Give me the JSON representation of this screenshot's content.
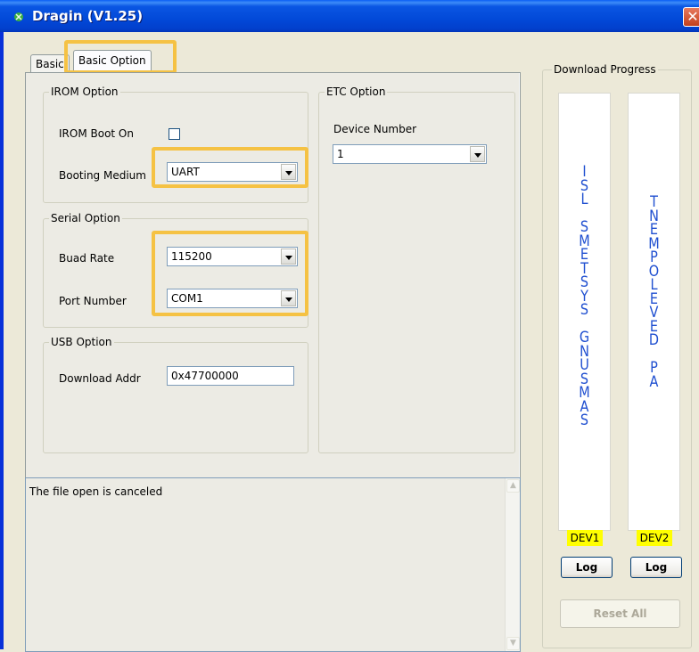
{
  "window": {
    "title": "Dragin (V1.25)",
    "close_icon": "close-icon"
  },
  "tabs": [
    {
      "label": "Basic",
      "active": false
    },
    {
      "label": "Basic Option",
      "active": true
    }
  ],
  "irom": {
    "group_label": "IROM Option",
    "boot_on_label": "IROM Boot On",
    "boot_on_checked": false,
    "booting_medium_label": "Booting Medium",
    "booting_medium_value": "UART"
  },
  "serial": {
    "group_label": "Serial Option",
    "baud_label": "Buad Rate",
    "baud_value": "115200",
    "port_label": "Port Number",
    "port_value": "COM1"
  },
  "usb": {
    "group_label": "USB Option",
    "addr_label": "Download Addr",
    "addr_value": "0x47700000"
  },
  "etc": {
    "group_label": "ETC Option",
    "device_number_label": "Device Number",
    "device_number_value": "1"
  },
  "log": {
    "text": "The file open is canceled"
  },
  "download": {
    "group_label": "Download Progress",
    "dev1_vertical_text": "SAMSUNG SYSTEMS LSI",
    "dev2_vertical_text": "AP DEVELOPMENT",
    "dev1_label": "DEV1",
    "dev2_label": "DEV2",
    "log_button": "Log",
    "reset_button": "Reset All"
  },
  "colors": {
    "highlight": "#f5c244",
    "dev_label_bg": "#ffff00",
    "progress_text": "#1f4fd0"
  }
}
